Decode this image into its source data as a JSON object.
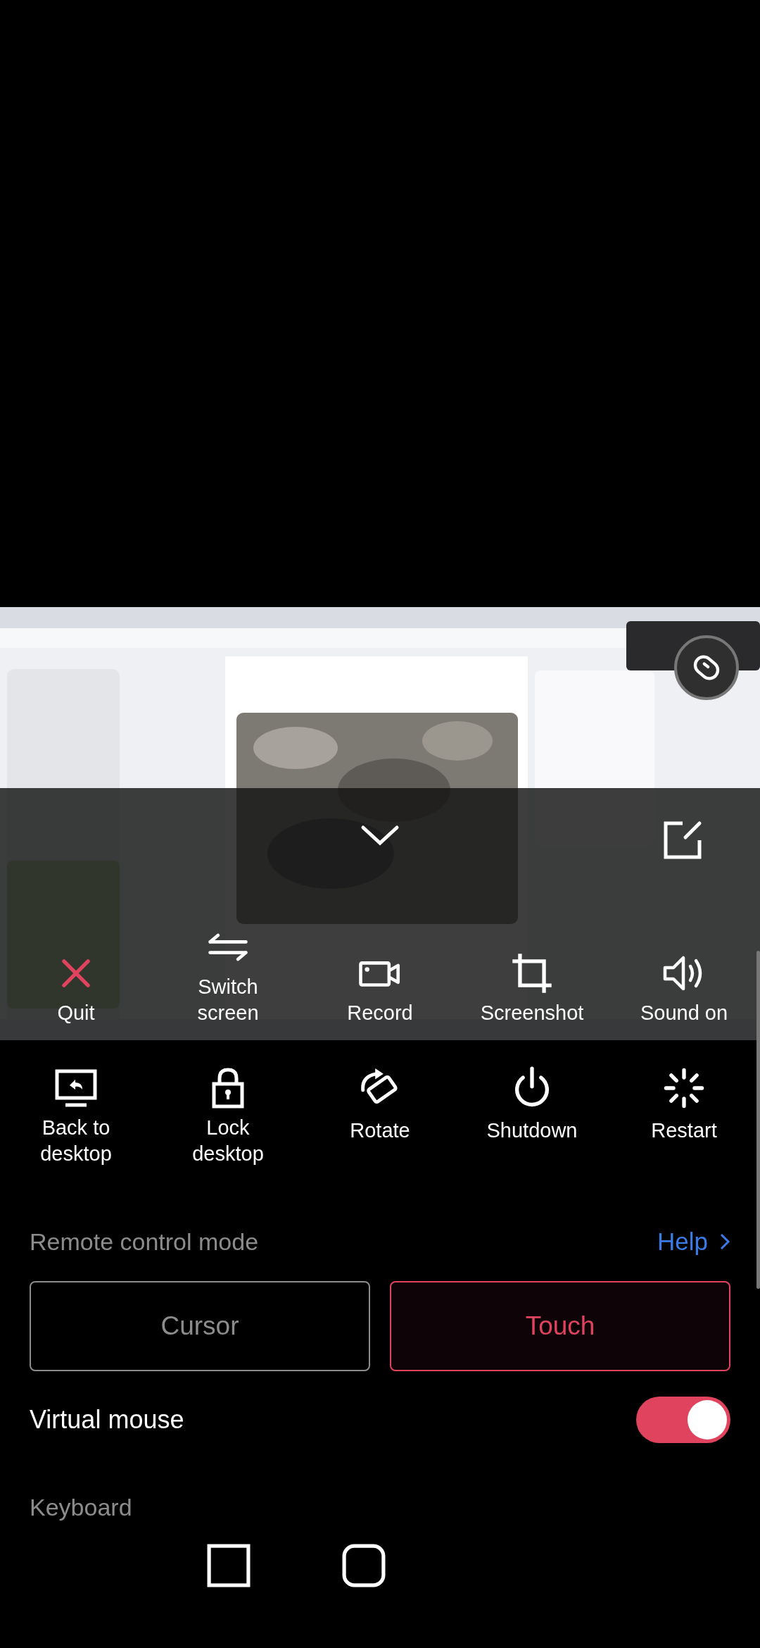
{
  "top_actions": [
    {
      "label": "Quit",
      "kind": "quit"
    },
    {
      "label": "Switch screen",
      "kind": "switch"
    },
    {
      "label": "Record",
      "kind": "record"
    },
    {
      "label": "Screenshot",
      "kind": "screenshot"
    },
    {
      "label": "Sound on",
      "kind": "sound"
    }
  ],
  "bottom_actions": [
    {
      "label": "Back to desktop",
      "kind": "desktop"
    },
    {
      "label": "Lock desktop",
      "kind": "lock"
    },
    {
      "label": "Rotate",
      "kind": "rotate"
    },
    {
      "label": "Shutdown",
      "kind": "shutdown"
    },
    {
      "label": "Restart",
      "kind": "restart"
    }
  ],
  "remote_control_mode": {
    "title": "Remote control mode",
    "help": "Help",
    "options": [
      {
        "label": "Cursor",
        "selected": false
      },
      {
        "label": "Touch",
        "selected": true
      }
    ]
  },
  "virtual_mouse": {
    "label": "Virtual mouse",
    "on": true
  },
  "keyboard": {
    "title": "Keyboard"
  }
}
